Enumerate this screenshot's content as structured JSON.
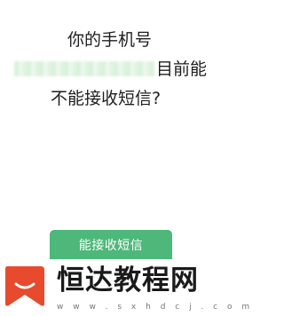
{
  "question": {
    "line1": "你的手机号",
    "line2_suffix": "目前能",
    "line3": "不能接收短信?"
  },
  "actions": {
    "confirm_label": "能接收短信"
  },
  "watermark": {
    "title": "恒达教程网",
    "url": "w w w . s x h d c j . c o m"
  },
  "colors": {
    "button": "#4db87a",
    "logo": "#e84a2e",
    "text": "#1e1e1e"
  },
  "icons": {
    "logo": "bookmark-logo-icon"
  }
}
